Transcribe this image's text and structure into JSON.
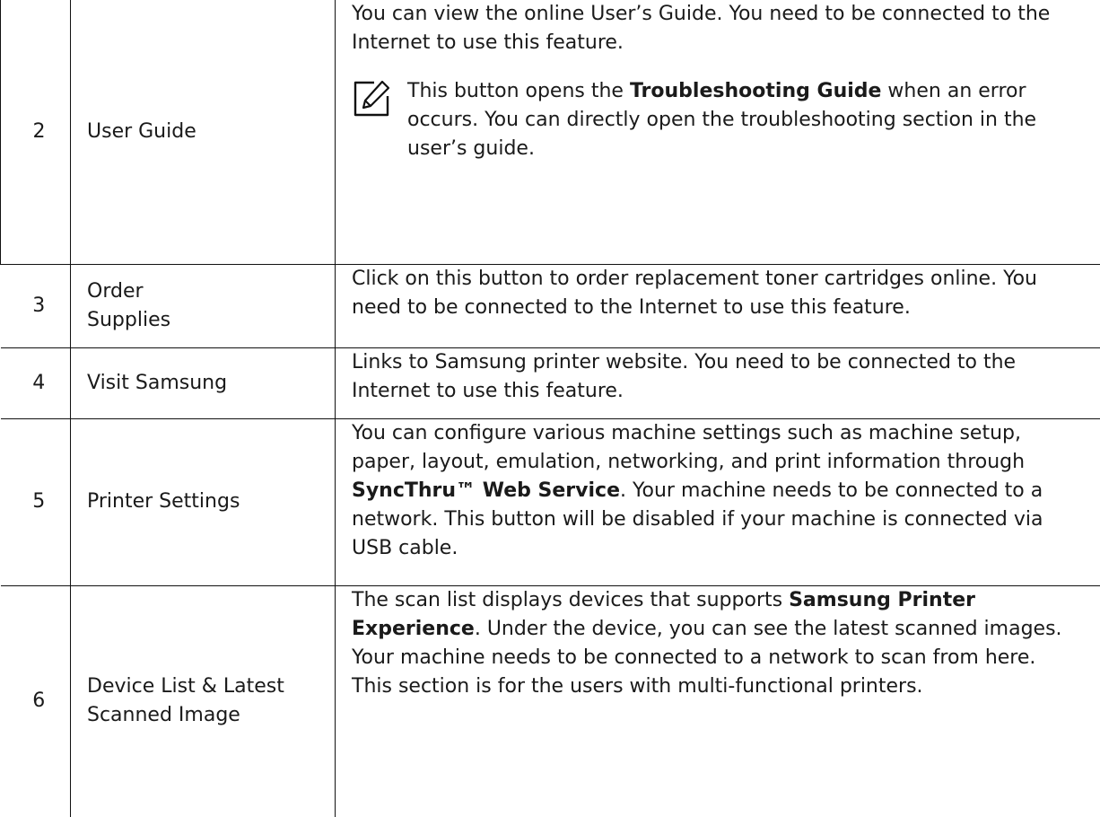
{
  "rows": [
    {
      "number": "2",
      "name": "User Guide",
      "description": [
        {
          "text": "You can view the online User’s Guide. You need to be connected to the Internet to use this feature.",
          "bold": false
        }
      ],
      "note": {
        "icon": "note-pencil-icon",
        "segments": [
          {
            "text": "This button opens the ",
            "bold": false
          },
          {
            "text": "Troubleshooting Guide",
            "bold": true
          },
          {
            "text": " when an error occurs. You can directly open the troubleshooting section in the user’s guide.",
            "bold": false
          }
        ]
      }
    },
    {
      "number": "3",
      "name": "Order\nSupplies",
      "description": [
        {
          "text": "Click on this button to order replacement toner cartridges online. You need to be connected to the Internet to use this feature.",
          "bold": false
        }
      ]
    },
    {
      "number": "4",
      "name": "Visit Samsung",
      "description": [
        {
          "text": "Links to Samsung printer website. You need to be connected to the Internet to use this feature.",
          "bold": false
        }
      ]
    },
    {
      "number": "5",
      "name": "Printer Settings",
      "description": [
        {
          "text": "You can configure various machine settings such as machine setup, paper, layout, emulation, networking, and print information through ",
          "bold": false
        },
        {
          "text": "SyncThru™ Web Service",
          "bold": true
        },
        {
          "text": ". Your machine needs to be connected to a network. This button will be disabled if your machine is connected via USB cable.",
          "bold": false
        }
      ]
    },
    {
      "number": "6",
      "name_segments": [
        {
          "text": "Device List",
          "bold": false
        },
        {
          "text": " & ",
          "bold": false
        },
        {
          "text": "Latest Scanned Image",
          "bold": false
        }
      ],
      "description": [
        {
          "text": "The scan list displays devices that supports ",
          "bold": false
        },
        {
          "text": "Samsung Printer Experience",
          "bold": true
        },
        {
          "text": ". Under the device, you can see the latest scanned images. Your machine needs to be connected to a network to scan from here.",
          "bold": false
        }
      ],
      "extra_paragraph": "This section is for the users with multi-functional printers."
    }
  ]
}
